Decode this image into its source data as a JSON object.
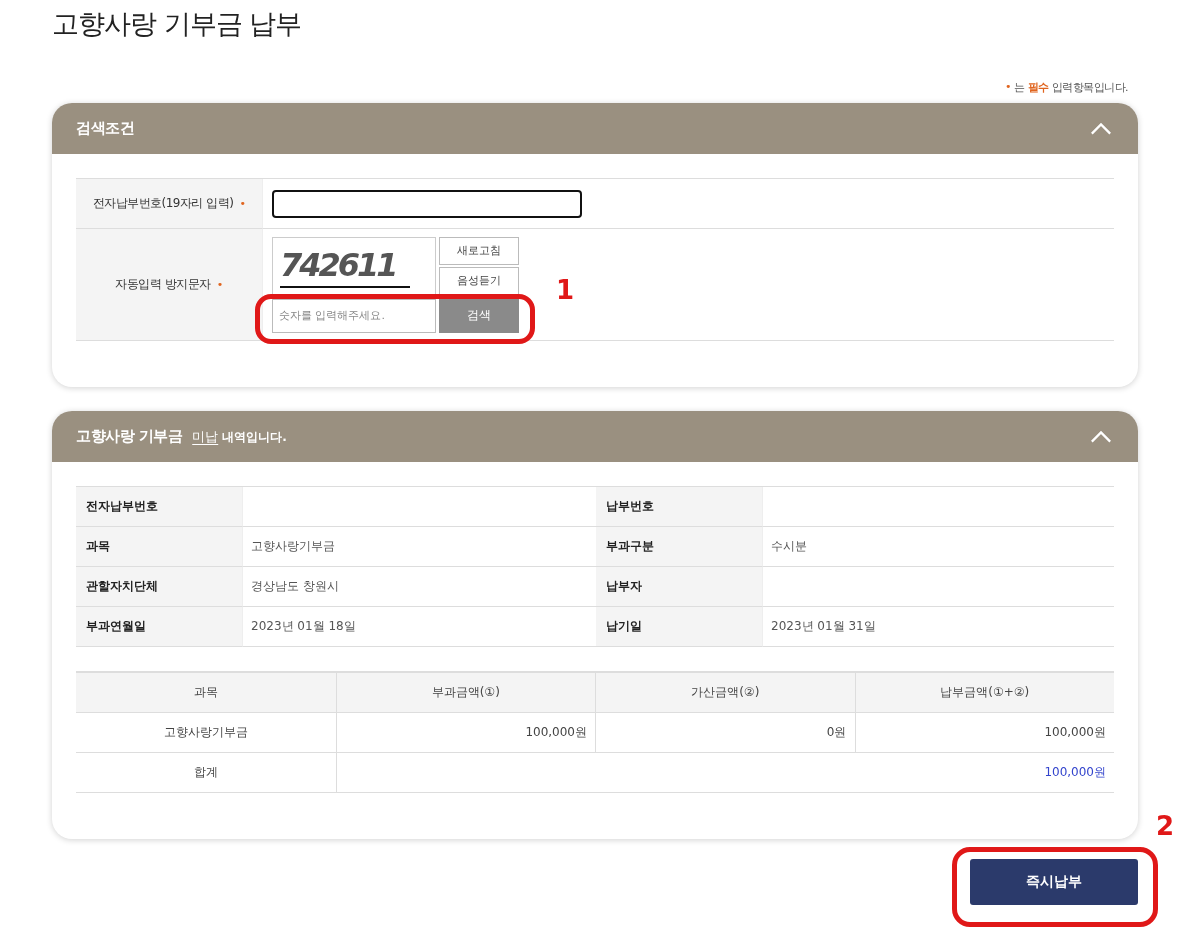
{
  "page_title": "고향사랑 기부금 납부",
  "required_note": {
    "mark": "•",
    "before": "는",
    "emphasis": "필수",
    "after": "입력항목입니다."
  },
  "search_panel": {
    "title": "검색조건",
    "expanded": true,
    "rows": [
      {
        "kind": "input",
        "label": "전자납부번호(19자리 입력)",
        "required": true
      },
      {
        "kind": "captcha",
        "label": "자동입력 방지문자",
        "required": true,
        "captcha": "742611",
        "refresh": "새로고침",
        "listen": "음성듣기",
        "placeholder": "숫자를 입력해주세요.",
        "submit": "검색",
        "annotation": "1"
      }
    ]
  },
  "result_panel": {
    "title": "고향사랑 기부금",
    "status": "미납",
    "title_suffix": "내역입니다.",
    "expanded": true,
    "details": [
      {
        "label": "전자납부번호"
      },
      {
        "label": "납부번호"
      },
      {
        "label": "과목",
        "value": "고향사랑기부금"
      },
      {
        "label": "부과구분",
        "value": "수시분"
      },
      {
        "label": "관할자치단체",
        "value": "경상남도 창원시"
      },
      {
        "label": "납부자"
      },
      {
        "label": "부과연월일",
        "value": "2023년 01월 18일"
      },
      {
        "label": "납기일",
        "value": "2023년 01월 31일"
      }
    ],
    "amounts": {
      "columns": [
        "과목",
        "부과금액(①)",
        "가산금액(②)",
        "납부금액(①+②)"
      ],
      "rows": [
        {
          "cells": [
            "고향사랑기부금",
            "100,000원",
            "0원",
            "100,000원"
          ]
        }
      ],
      "total": {
        "label": "합계",
        "value": "100,000원"
      }
    }
  },
  "pay_button": {
    "label": "즉시납부",
    "annotation": "2"
  }
}
